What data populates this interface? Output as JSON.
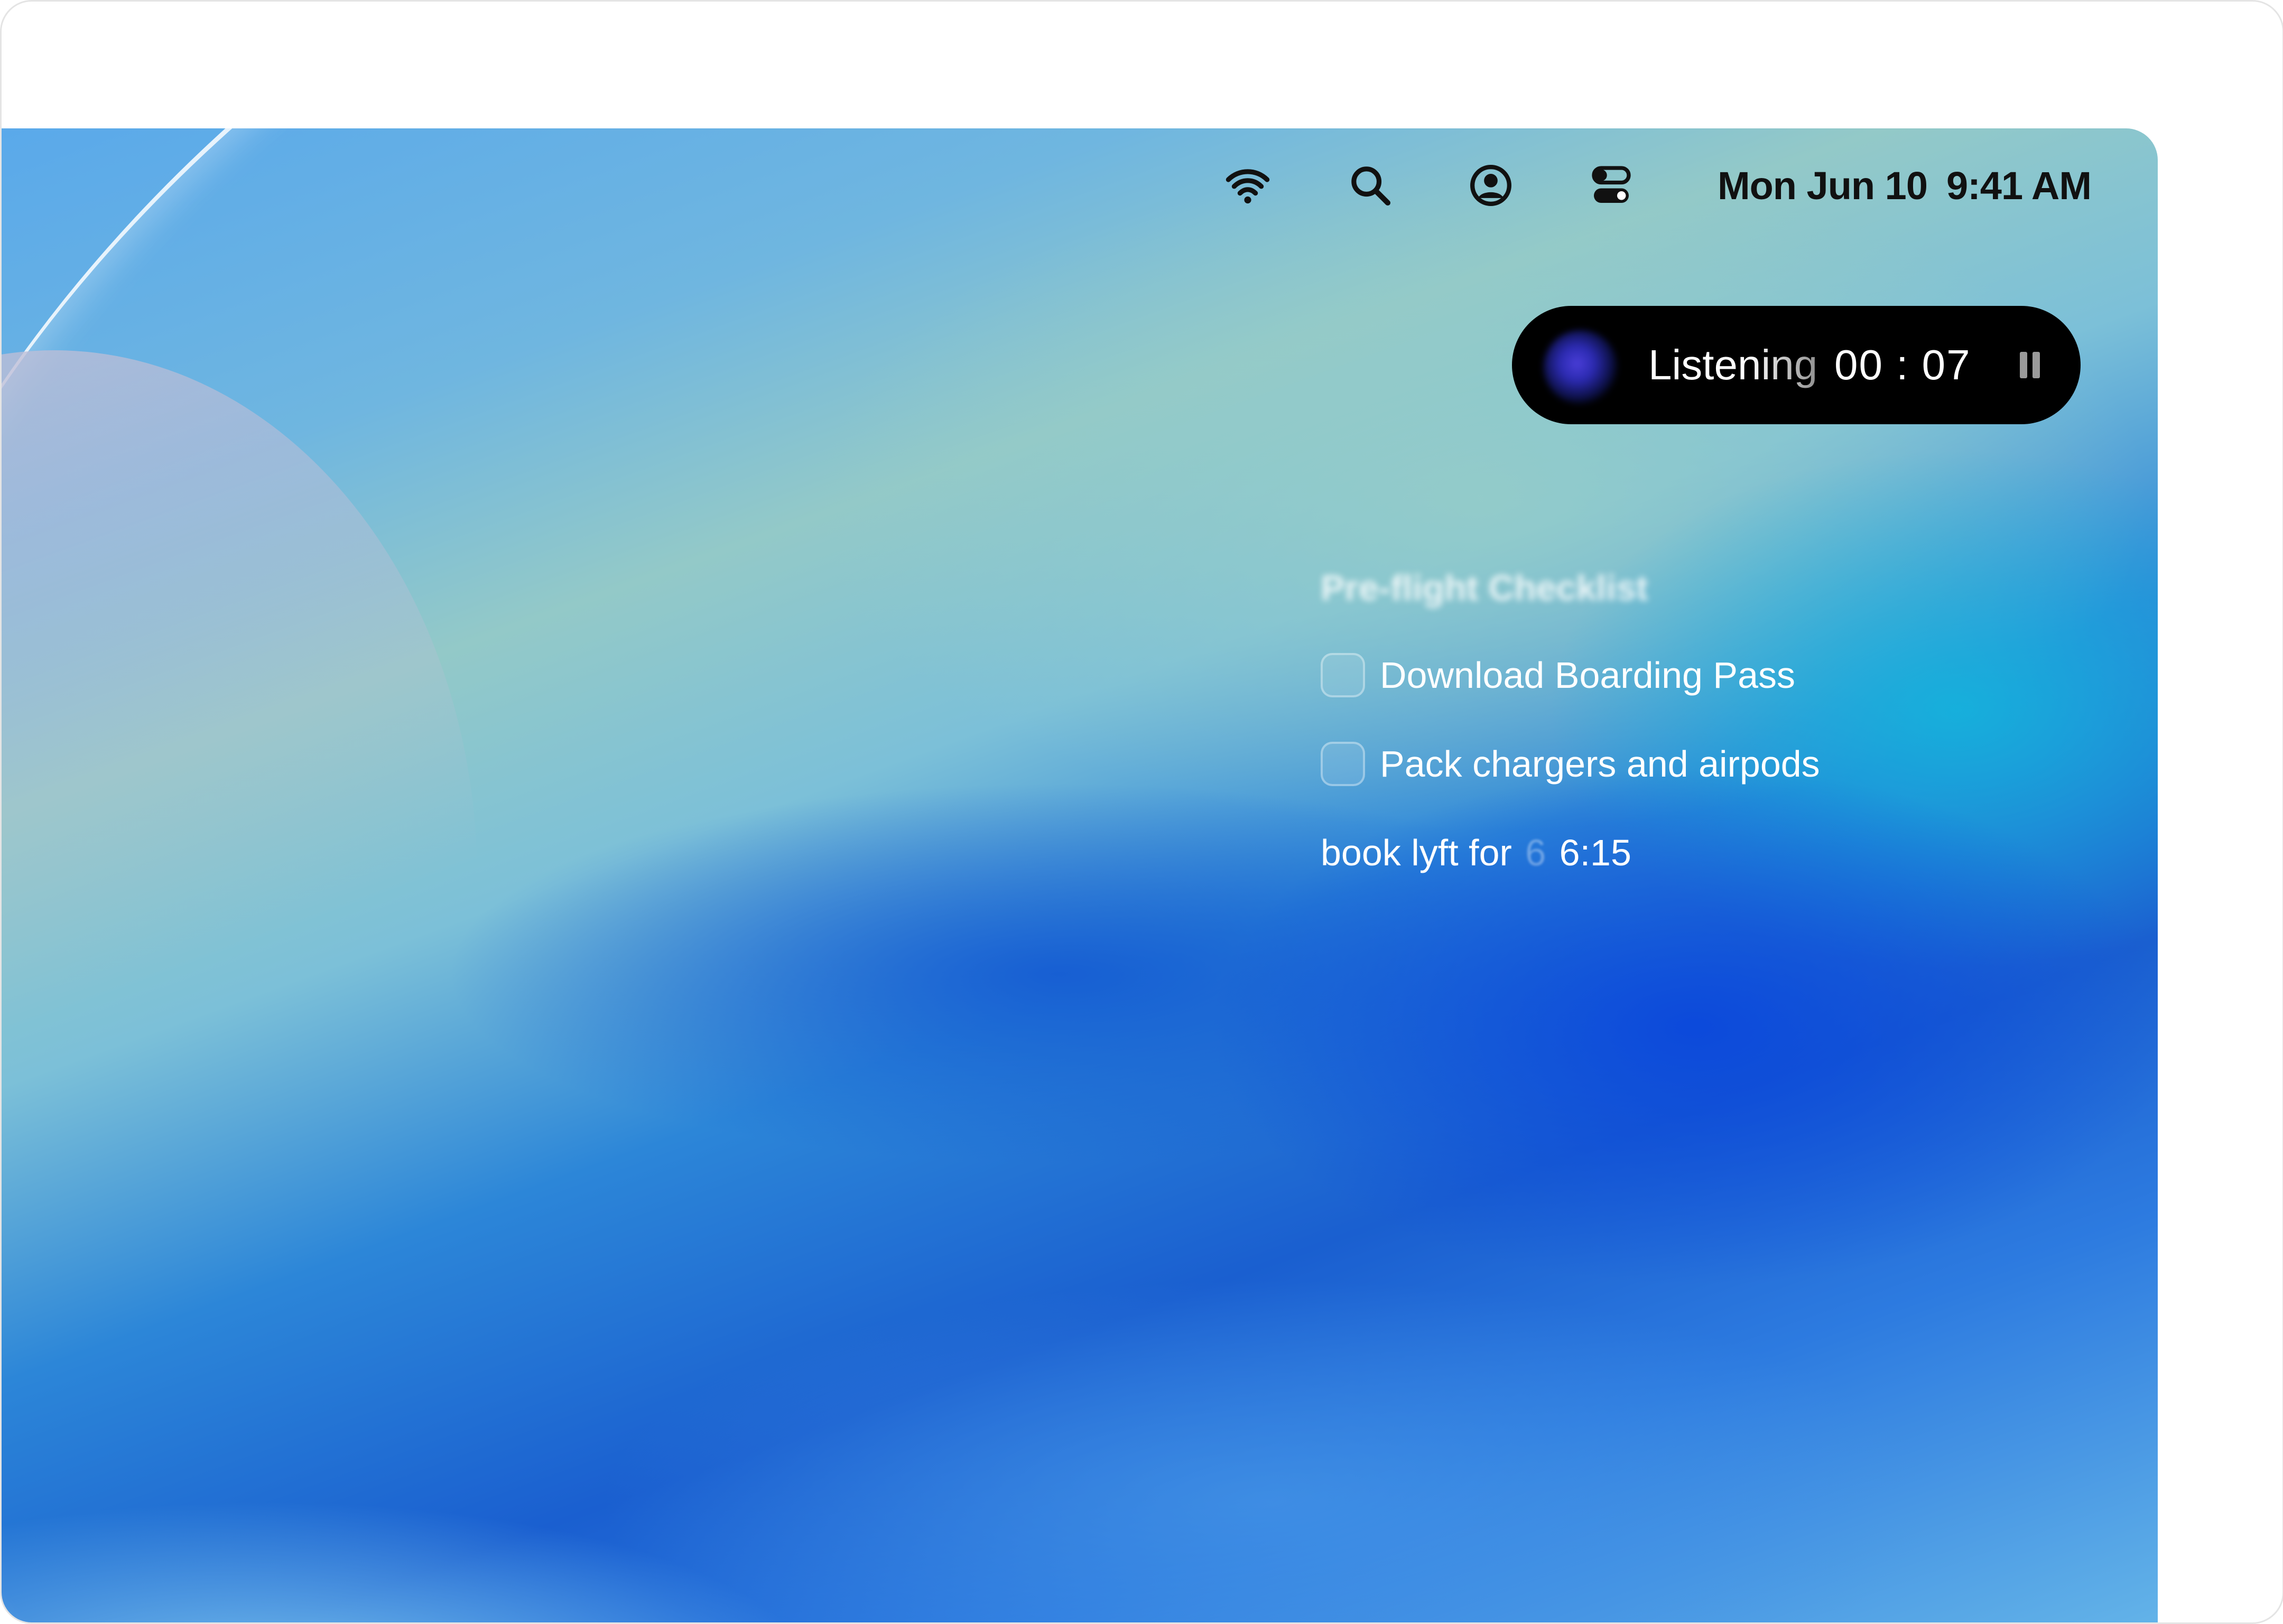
{
  "menubar": {
    "icons": {
      "wifi": "wifi-icon",
      "search": "search-icon",
      "user": "user-icon",
      "control_center": "control-center-icon"
    },
    "date": "Mon Jun 10",
    "time": "9:41 AM"
  },
  "recorder": {
    "status": "Listening",
    "timer": "00 : 07",
    "pause_icon": "pause-icon"
  },
  "note": {
    "title": "Pre-flight Checklist",
    "items": [
      {
        "label": "Download Boarding Pass",
        "checked": false
      },
      {
        "label": "Pack chargers and airpods",
        "checked": false
      }
    ],
    "dictation": {
      "prefix": "book lyft for",
      "faded": "6",
      "suffix": "6:15"
    }
  },
  "colors": {
    "pill_background": "#000000",
    "menubar_text": "#111111",
    "text_on_wallpaper": "#ffffff"
  }
}
